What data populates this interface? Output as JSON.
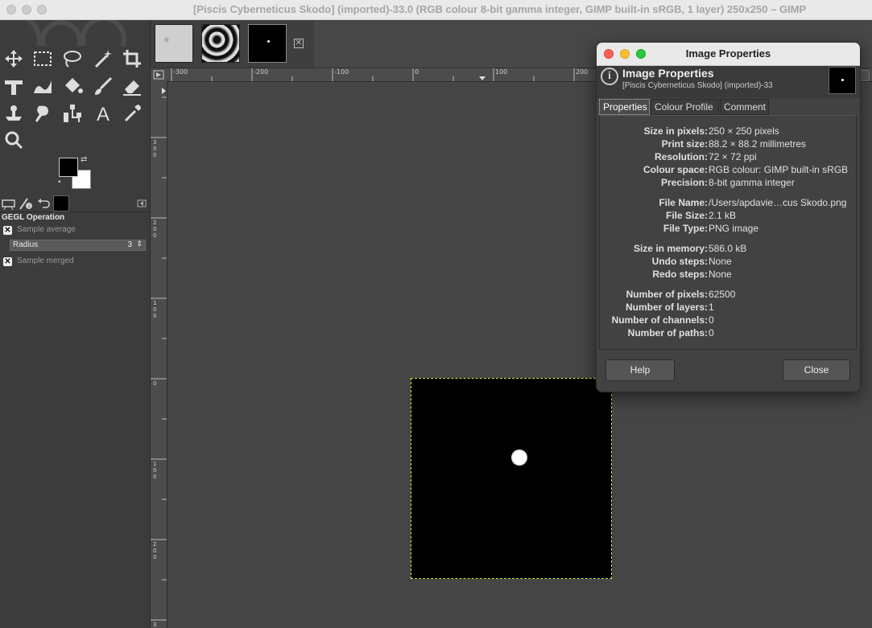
{
  "window": {
    "title": "[Piscis Cyberneticus Skodo] (imported)-33.0 (RGB colour 8-bit gamma integer, GIMP built-in sRGB, 1 layer) 250x250 – GIMP"
  },
  "toolbox": {
    "tools": [
      {
        "name": "move-tool-icon"
      },
      {
        "name": "rect-select-tool-icon"
      },
      {
        "name": "free-select-tool-icon"
      },
      {
        "name": "fuzzy-select-tool-icon"
      },
      {
        "name": "crop-tool-icon"
      },
      {
        "name": "unified-transform-tool-icon"
      },
      {
        "name": "warp-transform-tool-icon"
      },
      {
        "name": "bucket-fill-tool-icon"
      },
      {
        "name": "paintbrush-tool-icon"
      },
      {
        "name": "eraser-tool-icon"
      },
      {
        "name": "clone-tool-icon"
      },
      {
        "name": "smudge-tool-icon"
      },
      {
        "name": "paths-tool-icon"
      },
      {
        "name": "text-tool-icon"
      },
      {
        "name": "color-picker-tool-icon"
      },
      {
        "name": "zoom-tool-icon"
      }
    ],
    "foreground_color": "#000000",
    "background_color": "#ffffff"
  },
  "tool_options": {
    "title": "GEGL Operation",
    "sample_average_label": "Sample average",
    "radius_label": "Radius",
    "radius_value": "3",
    "sample_merged_label": "Sample merged"
  },
  "rulers": {
    "top_ticks": [
      "-300",
      "-200",
      "-100",
      "0",
      "100",
      "200"
    ],
    "left_ticks": [
      "300",
      "200",
      "100",
      "0",
      "100",
      "200",
      "3"
    ]
  },
  "dialog": {
    "title": "Image Properties",
    "header_title": "Image Properties",
    "header_subtitle": "[Piscis Cyberneticus Skodo] (imported)-33",
    "tabs": [
      "Properties",
      "Colour Profile",
      "Comment"
    ],
    "properties": [
      {
        "key": "Size in pixels:",
        "value": "250 × 250 pixels"
      },
      {
        "key": "Print size:",
        "value": "88.2 × 88.2 millimetres"
      },
      {
        "key": "Resolution:",
        "value": "72 × 72 ppi"
      },
      {
        "key": "Colour space:",
        "value": "RGB colour: GIMP built-in sRGB"
      },
      {
        "key": "Precision:",
        "value": "8-bit gamma integer"
      },
      {
        "key": "File Name:",
        "value": "/Users/apdavie…cus Skodo.png"
      },
      {
        "key": "File Size:",
        "value": "2.1 kB"
      },
      {
        "key": "File Type:",
        "value": "PNG image"
      },
      {
        "key": "Size in memory:",
        "value": "586.0 kB"
      },
      {
        "key": "Undo steps:",
        "value": "None"
      },
      {
        "key": "Redo steps:",
        "value": "None"
      },
      {
        "key": "Number of pixels:",
        "value": "62500"
      },
      {
        "key": "Number of layers:",
        "value": "1"
      },
      {
        "key": "Number of channels:",
        "value": "0"
      },
      {
        "key": "Number of paths:",
        "value": "0"
      }
    ],
    "help_label": "Help",
    "close_label": "Close"
  },
  "colors": {
    "selection_outline": "#e2e23a",
    "close_light": "#ff5f57",
    "minimize_light": "#febc2e",
    "zoom_light": "#28c840"
  }
}
